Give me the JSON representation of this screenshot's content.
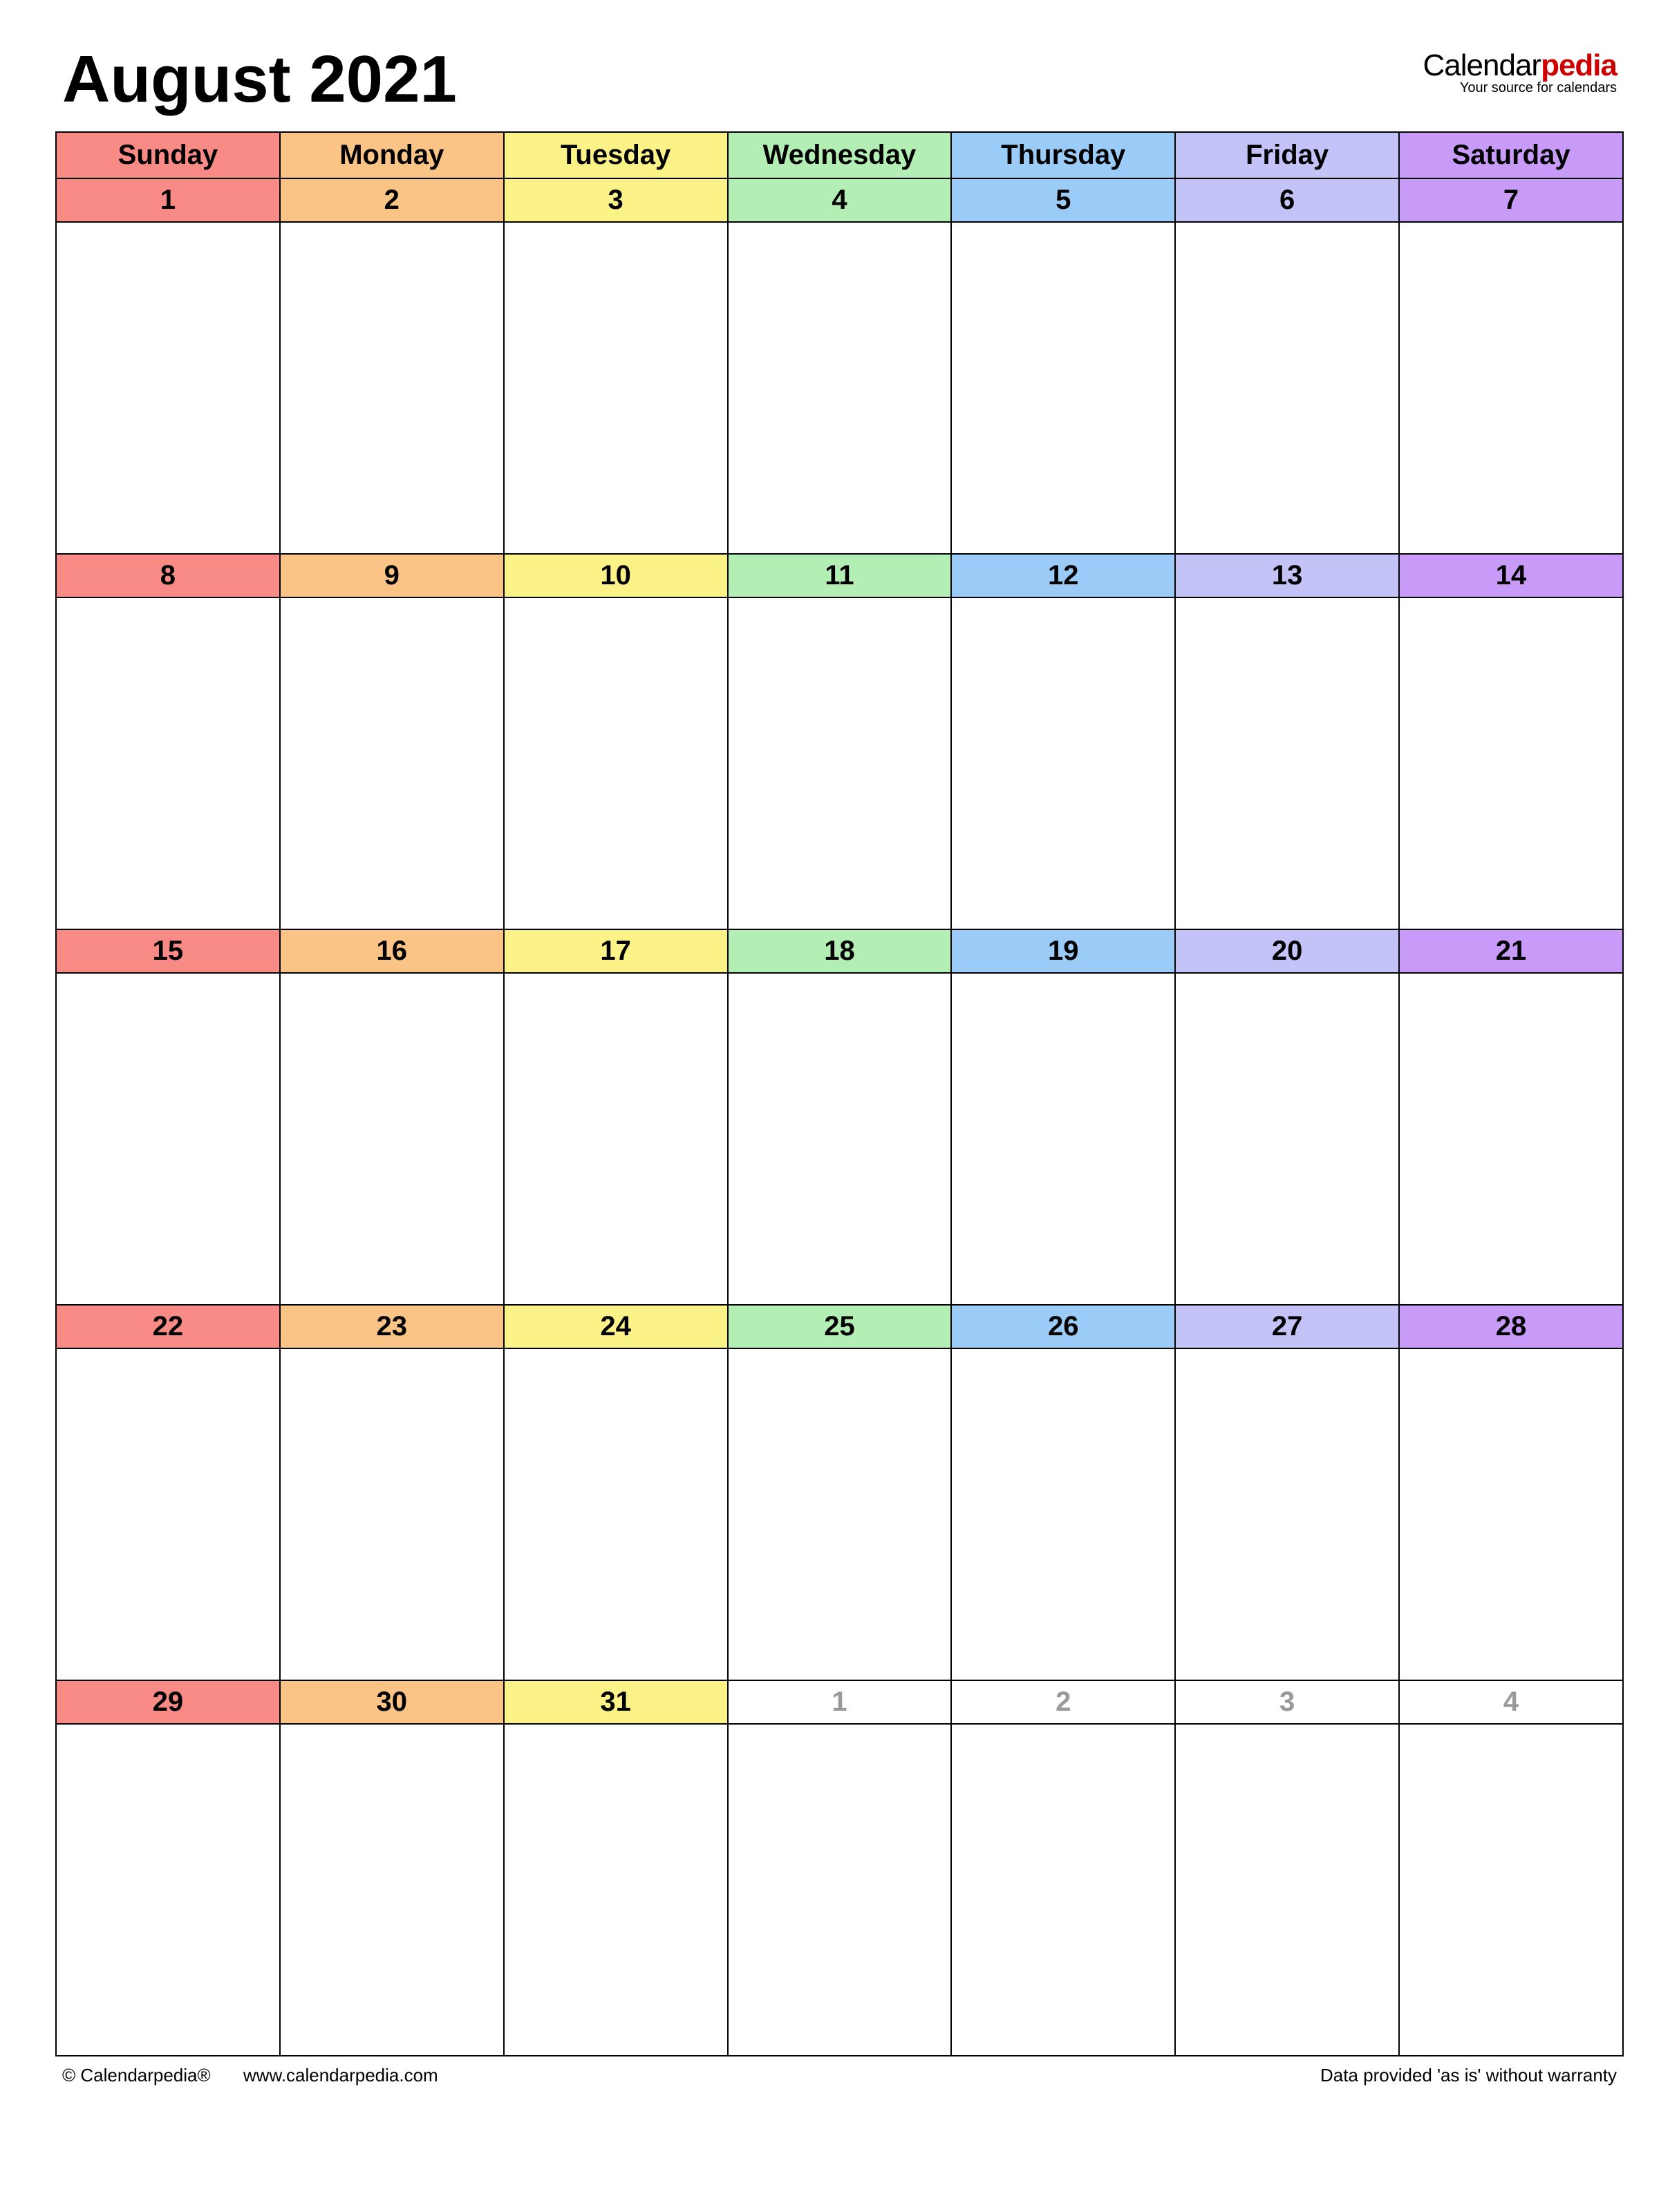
{
  "title": "August 2021",
  "brand": {
    "part1": "Calendar",
    "part2": "pedia",
    "tagline": "Your source for calendars"
  },
  "colors": {
    "sun": "#f88b85",
    "mon": "#fac486",
    "tue": "#fbf288",
    "wed": "#b3efb4",
    "thu": "#9bccf7",
    "fri": "#c3c3f7",
    "sat": "#c79bf7"
  },
  "days": [
    "Sunday",
    "Monday",
    "Tuesday",
    "Wednesday",
    "Thursday",
    "Friday",
    "Saturday"
  ],
  "weeks": [
    [
      {
        "n": "1",
        "in": true
      },
      {
        "n": "2",
        "in": true
      },
      {
        "n": "3",
        "in": true
      },
      {
        "n": "4",
        "in": true
      },
      {
        "n": "5",
        "in": true
      },
      {
        "n": "6",
        "in": true
      },
      {
        "n": "7",
        "in": true
      }
    ],
    [
      {
        "n": "8",
        "in": true
      },
      {
        "n": "9",
        "in": true
      },
      {
        "n": "10",
        "in": true
      },
      {
        "n": "11",
        "in": true
      },
      {
        "n": "12",
        "in": true
      },
      {
        "n": "13",
        "in": true
      },
      {
        "n": "14",
        "in": true
      }
    ],
    [
      {
        "n": "15",
        "in": true
      },
      {
        "n": "16",
        "in": true
      },
      {
        "n": "17",
        "in": true
      },
      {
        "n": "18",
        "in": true
      },
      {
        "n": "19",
        "in": true
      },
      {
        "n": "20",
        "in": true
      },
      {
        "n": "21",
        "in": true
      }
    ],
    [
      {
        "n": "22",
        "in": true
      },
      {
        "n": "23",
        "in": true
      },
      {
        "n": "24",
        "in": true
      },
      {
        "n": "25",
        "in": true
      },
      {
        "n": "26",
        "in": true
      },
      {
        "n": "27",
        "in": true
      },
      {
        "n": "28",
        "in": true
      }
    ],
    [
      {
        "n": "29",
        "in": true
      },
      {
        "n": "30",
        "in": true
      },
      {
        "n": "31",
        "in": true
      },
      {
        "n": "1",
        "in": false
      },
      {
        "n": "2",
        "in": false
      },
      {
        "n": "3",
        "in": false
      },
      {
        "n": "4",
        "in": false
      }
    ]
  ],
  "footer": {
    "copyright": "© Calendarpedia®",
    "url": "www.calendarpedia.com",
    "disclaimer": "Data provided 'as is' without warranty"
  }
}
